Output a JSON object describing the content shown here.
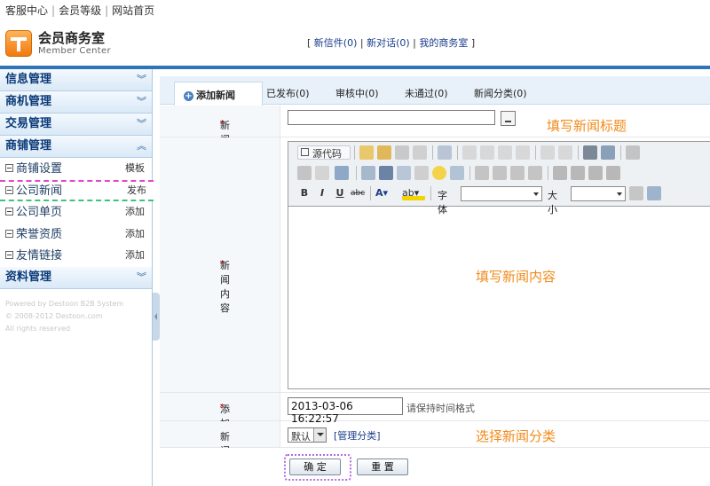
{
  "top_links": [
    "客服中心",
    "会员等级",
    "网站首页"
  ],
  "header": {
    "title": "会员商务室",
    "subtitle": "Member Center",
    "links": [
      "新信件(0)",
      "新对话(0)",
      "我的商务室"
    ]
  },
  "sidebar": {
    "menus": [
      {
        "label": "信息管理",
        "arrow": "»"
      },
      {
        "label": "商机管理",
        "arrow": "»"
      },
      {
        "label": "交易管理",
        "arrow": "»"
      },
      {
        "label": "商铺管理",
        "arrow": "«"
      }
    ],
    "items": [
      {
        "label": "商铺设置",
        "action": "模板"
      },
      {
        "label": "公司新闻",
        "action": "发布"
      },
      {
        "label": "公司单页",
        "action": "添加"
      },
      {
        "label": "荣誉资质",
        "action": "添加"
      },
      {
        "label": "友情链接",
        "action": "添加"
      }
    ],
    "last_menu": {
      "label": "资料管理",
      "arrow": "»"
    },
    "footer": [
      "Powered by Destoon B2B System",
      "© 2008-2012 Destoon.com",
      "All rights reserved"
    ]
  },
  "tabs": {
    "active": "添加新闻",
    "others": [
      "已发布(0)",
      "审核中(0)",
      "未通过(0)",
      "新闻分类(0)"
    ]
  },
  "form": {
    "title_label": "新闻标题",
    "title_hint": "填写新闻标题",
    "content_label": "新闻内容",
    "content_hint": "填写新闻内容",
    "editor": {
      "source_label": "源代码",
      "font_label": "字体",
      "size_label": "大小"
    },
    "date_label": "添加时间",
    "date_value": "2013-03-06 16:22:57",
    "date_hint": "请保持时间格式",
    "category_label": "新闻分类",
    "category_value": "默认",
    "category_manage": "[管理分类]",
    "category_hint": "选择新闻分类",
    "ok_button": "确 定",
    "reset_button": "重 置"
  }
}
